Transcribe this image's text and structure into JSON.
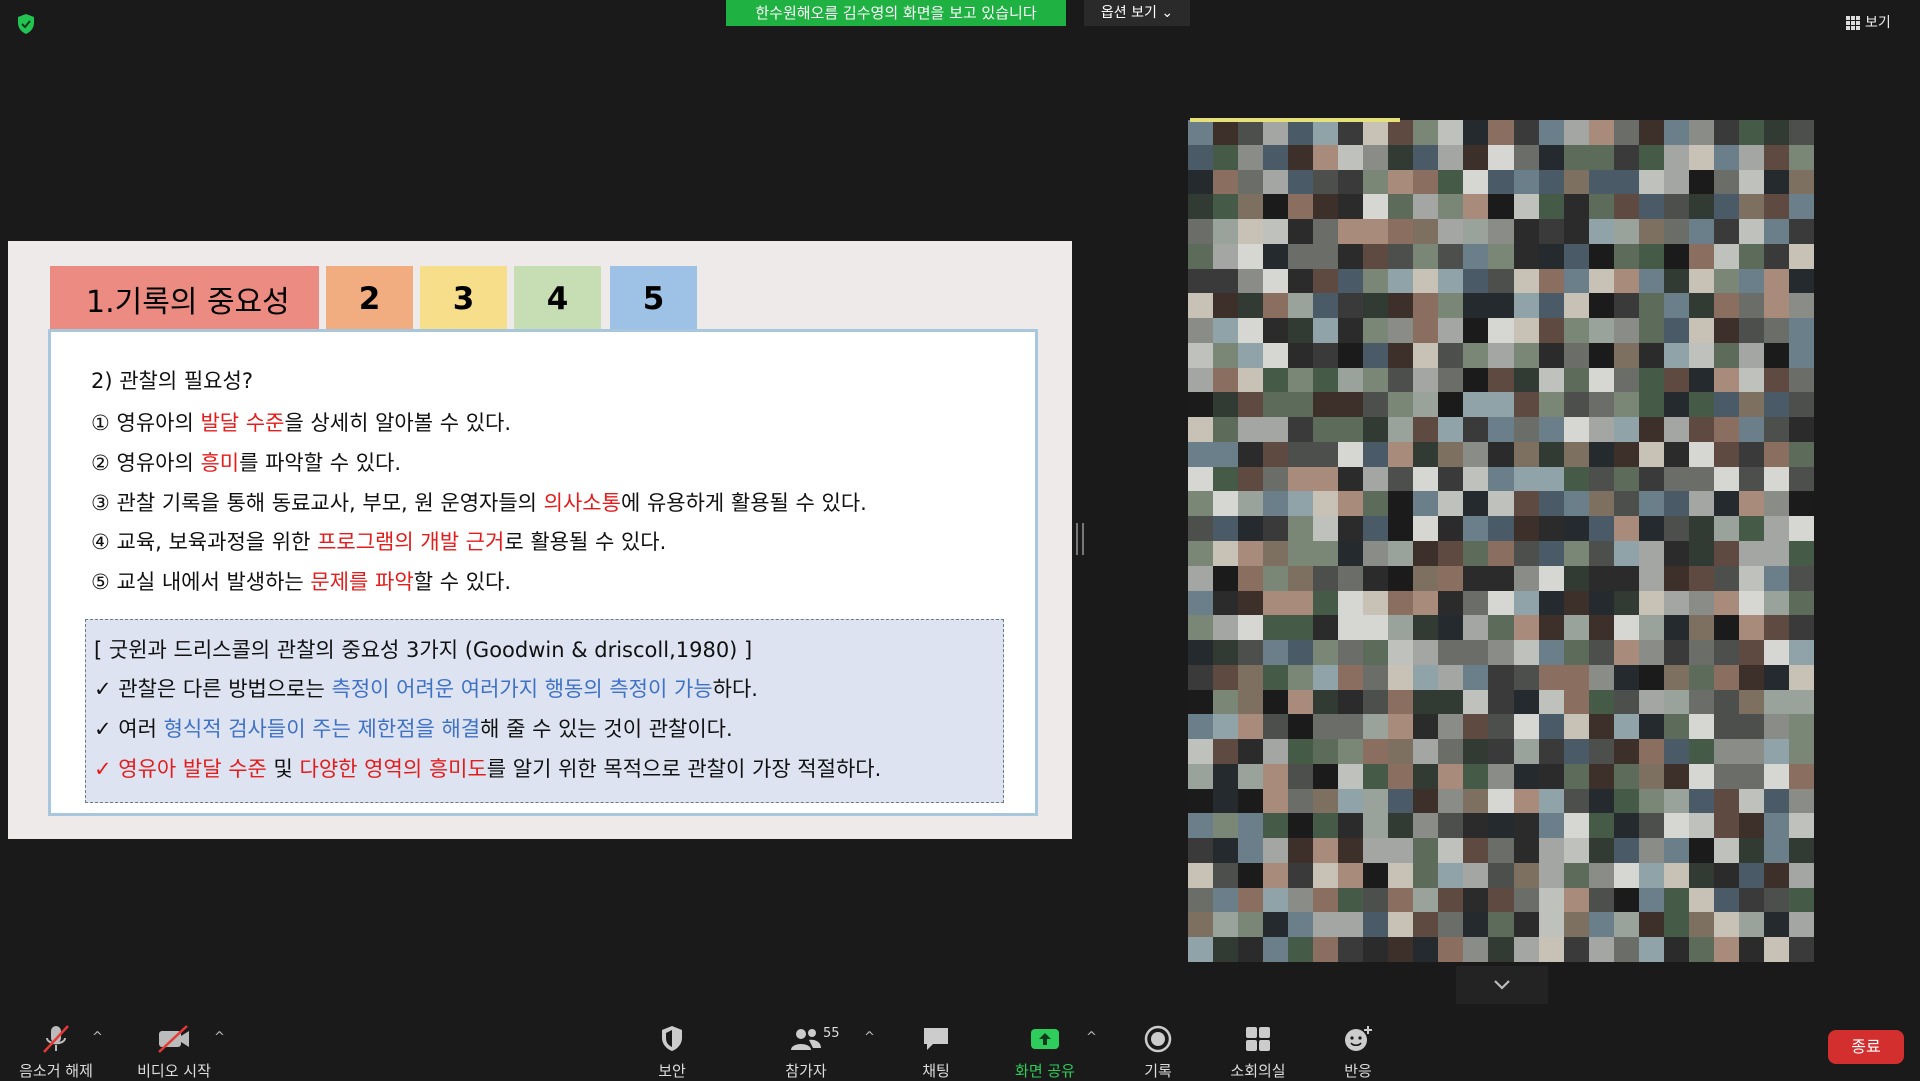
{
  "top": {
    "banner": "한수원해오름 김수영의 화면을 보고 있습니다",
    "view_options": "옵션 보기",
    "view_button": "보기"
  },
  "slide": {
    "tabs": [
      "1.기록의 중요성",
      "2",
      "3",
      "4",
      "5"
    ],
    "heading": "2) 관찰의 필요성?",
    "items": [
      {
        "pre": "① 영유아의 ",
        "hl": "발달 수준",
        "post": "을 상세히 알아볼 수 있다."
      },
      {
        "pre": "② 영유아의 ",
        "hl": "흥미",
        "post": "를 파악할 수 있다."
      },
      {
        "pre": "③ 관찰 기록을 통해 동료교사, 부모, 원 운영자들의 ",
        "hl": "의사소통",
        "post": "에 유용하게 활용될 수 있다."
      },
      {
        "pre": "④ 교육, 보육과정을 위한 ",
        "hl": "프로그램의 개발 근거",
        "post": "로 활용될 수 있다."
      },
      {
        "pre": "⑤ 교실 내에서 발생하는 ",
        "hl": "문제를 파악",
        "post": "할 수 있다."
      }
    ],
    "box_title": "[ 굿윈과 드리스콜의 관찰의 중요성 3가지 (Goodwin & driscoll,1980) ]",
    "box_lines": [
      {
        "pre": "✓ 관찰은 다른 방법으로는 ",
        "hl": "측정이 어려운 여러가지 행동의 측정이 가능",
        "post": "하다."
      },
      {
        "pre": "✓ 여러 ",
        "hl": "형식적 검사들이 주는 제한점을 해결",
        "post": "해 줄 수 있는 것이 관찰이다."
      },
      {
        "pre": "✓ 영유아 발달 수준",
        "mid": " 및 ",
        "hl": "다양한 영역의 흥미도",
        "post": "를 알기 위한 목적으로 관찰이 가장 적절하다."
      }
    ]
  },
  "toolbar": {
    "unmute": "음소거 해제",
    "start_video": "비디오 시작",
    "security": "보안",
    "participants": "참가자",
    "participant_count": "55",
    "chat": "채팅",
    "share_screen": "화면 공유",
    "record": "기록",
    "breakout": "소회의실",
    "reactions": "반응",
    "end": "종료"
  },
  "colors": {
    "banner_green": "#1fb141",
    "highlight_red": "#e41c1c",
    "highlight_blue": "#3f72c6",
    "end_red": "#d32f2f"
  }
}
